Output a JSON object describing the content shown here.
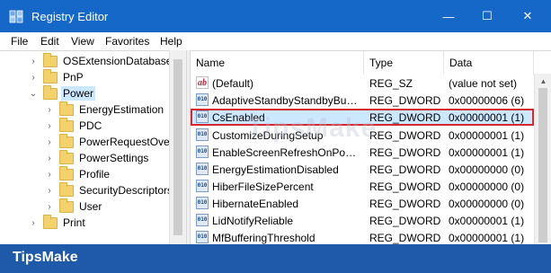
{
  "window": {
    "title": "Registry Editor",
    "controls": {
      "minimize": "—",
      "maximize": "☐",
      "close": "✕"
    }
  },
  "menu": [
    "File",
    "Edit",
    "View",
    "Favorites",
    "Help"
  ],
  "tree": [
    {
      "label": "OSExtensionDatabase",
      "expander": "›",
      "level": 0
    },
    {
      "label": "PnP",
      "expander": "›",
      "level": 0
    },
    {
      "label": "Power",
      "expander": "⌄",
      "level": 0,
      "selected": true
    },
    {
      "label": "EnergyEstimation",
      "expander": "›",
      "level": 1
    },
    {
      "label": "PDC",
      "expander": "›",
      "level": 1
    },
    {
      "label": "PowerRequestOver",
      "expander": "›",
      "level": 1
    },
    {
      "label": "PowerSettings",
      "expander": "›",
      "level": 1
    },
    {
      "label": "Profile",
      "expander": "›",
      "level": 1
    },
    {
      "label": "SecurityDescriptors",
      "expander": "›",
      "level": 1
    },
    {
      "label": "User",
      "expander": "›",
      "level": 1
    },
    {
      "label": "Print",
      "expander": "›",
      "level": 0
    }
  ],
  "columns": {
    "name": "Name",
    "type": "Type",
    "data": "Data"
  },
  "values": [
    {
      "icon": "ab",
      "icon_kind": "string",
      "name": "(Default)",
      "type": "REG_SZ",
      "data": "(value not set)"
    },
    {
      "icon": "010",
      "icon_kind": "binary",
      "name": "AdaptiveStandbyStandbyBud...",
      "type": "REG_DWORD",
      "data": "0x00000006 (6)"
    },
    {
      "icon": "010",
      "icon_kind": "binary",
      "name": "CsEnabled",
      "type": "REG_DWORD",
      "data": "0x00000001 (1)",
      "highlighted": true
    },
    {
      "icon": "010",
      "icon_kind": "binary",
      "name": "CustomizeDuringSetup",
      "type": "REG_DWORD",
      "data": "0x00000001 (1)"
    },
    {
      "icon": "010",
      "icon_kind": "binary",
      "name": "EnableScreenRefreshOnPowe...",
      "type": "REG_DWORD",
      "data": "0x00000001 (1)"
    },
    {
      "icon": "010",
      "icon_kind": "binary",
      "name": "EnergyEstimationDisabled",
      "type": "REG_DWORD",
      "data": "0x00000000 (0)"
    },
    {
      "icon": "010",
      "icon_kind": "binary",
      "name": "HiberFileSizePercent",
      "type": "REG_DWORD",
      "data": "0x00000000 (0)"
    },
    {
      "icon": "010",
      "icon_kind": "binary",
      "name": "HibernateEnabled",
      "type": "REG_DWORD",
      "data": "0x00000000 (0)"
    },
    {
      "icon": "010",
      "icon_kind": "binary",
      "name": "LidNotifyReliable",
      "type": "REG_DWORD",
      "data": "0x00000001 (1)"
    },
    {
      "icon": "010",
      "icon_kind": "binary",
      "name": "MfBufferingThreshold",
      "type": "REG_DWORD",
      "data": "0x00000001 (1)"
    }
  ],
  "brand": {
    "text": "TipsMake",
    "watermark": "TipsMake"
  },
  "colors": {
    "titlebar": "#1668c8",
    "selection": "#cce8ff",
    "highlight_border": "#d7282f",
    "brand_bar": "#1e5aa9"
  }
}
